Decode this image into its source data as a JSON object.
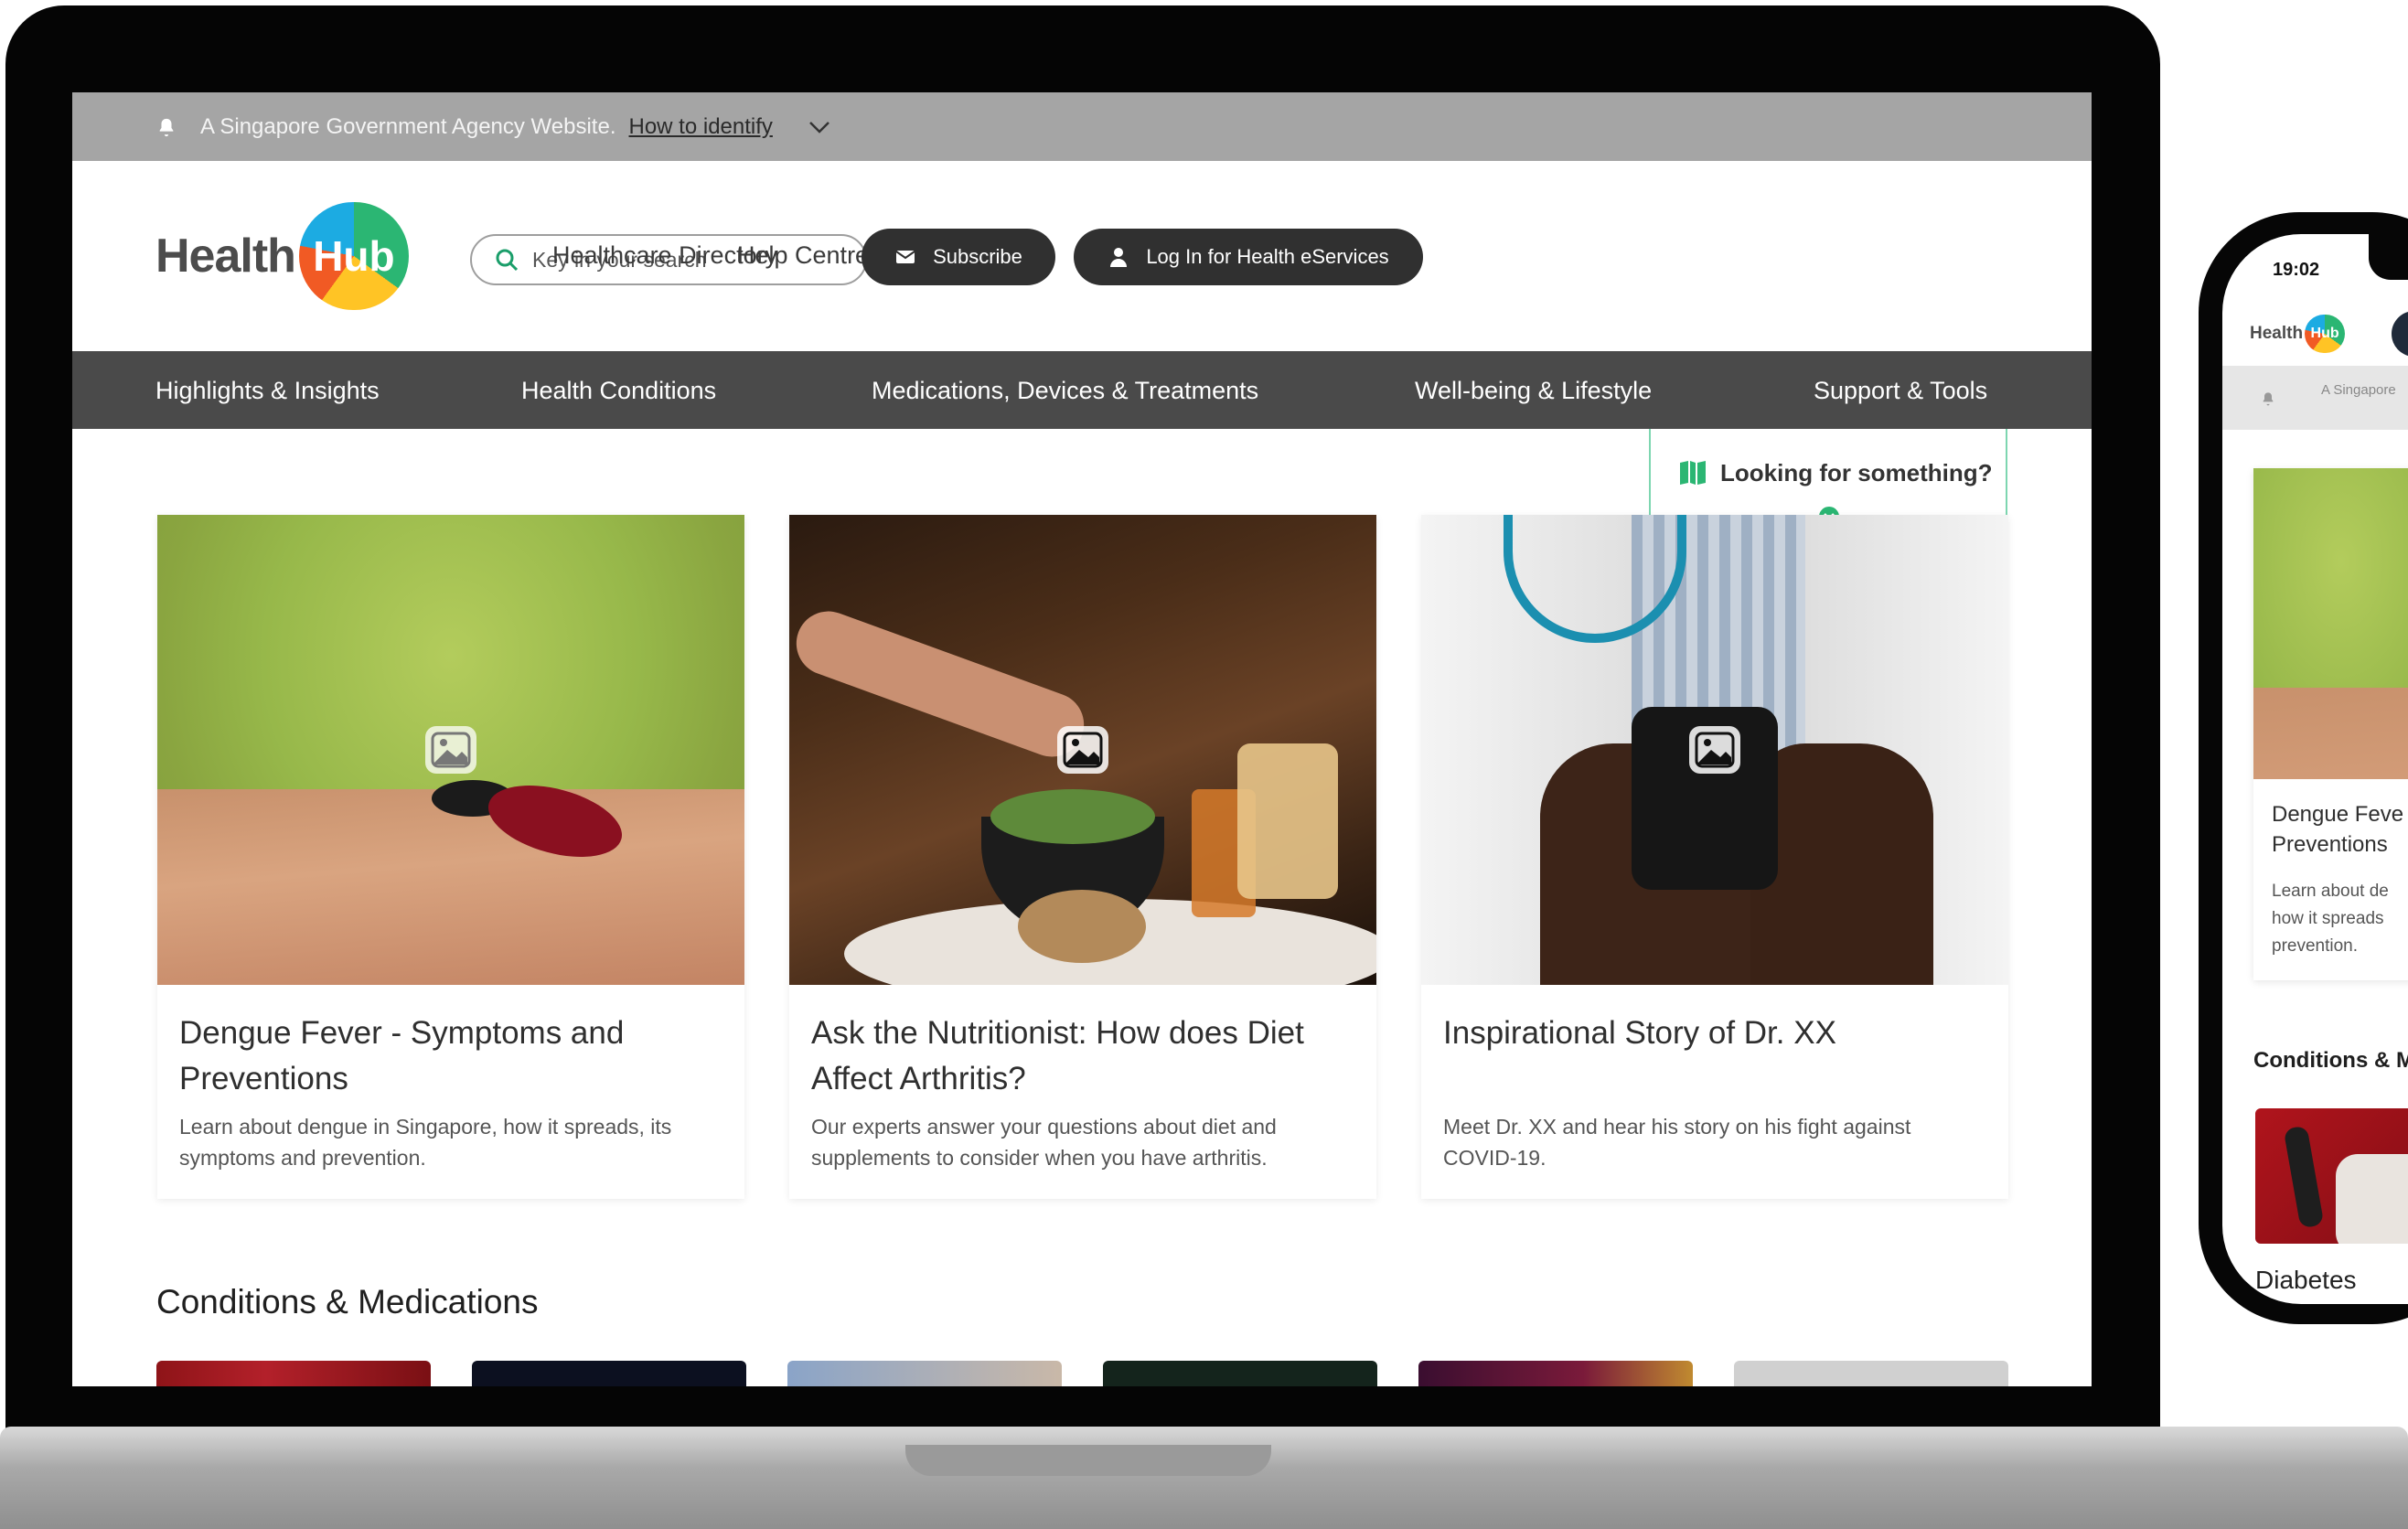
{
  "gov_banner": {
    "text": "A Singapore Government Agency Website.",
    "link": "How to identify"
  },
  "header": {
    "logo_health": "Health",
    "logo_hub": "Hub",
    "search_placeholder": "Key in your search",
    "links": [
      "Healthcare Directory",
      "Help Centre"
    ],
    "subscribe_label": "Subscribe",
    "login_label": "Log In for Health eServices"
  },
  "main_nav": [
    "Highlights & Insights",
    "Health Conditions",
    "Medications, Devices & Treatments",
    "Well-being & Lifestyle",
    "Support & Tools"
  ],
  "finder": {
    "label": "Looking for something?"
  },
  "cards": [
    {
      "title": "Dengue Fever - Symptoms and Preventions",
      "description": "Learn about dengue in Singapore, how it spreads, its symptoms and prevention."
    },
    {
      "title": "Ask the Nutritionist: How does Diet Affect Arthritis?",
      "description": "Our experts answer your questions about diet and supplements to consider when you have arthritis."
    },
    {
      "title": "Inspirational Story of Dr. XX",
      "description": "Meet Dr. XX and hear his story on his fight against COVID-19."
    }
  ],
  "conditions_section": {
    "title": "Conditions & Medications"
  },
  "phone": {
    "time": "19:02",
    "logo_health": "Health",
    "logo_hub": "Hub",
    "banner_text": "A Singapore",
    "card_title": "Dengue Fever - Symptoms and Preventions",
    "card_title_line1": "Dengue Feve",
    "card_title_line2": "Preventions",
    "card_desc_line1": "Learn about de",
    "card_desc_line2": "how it spreads",
    "card_desc_line3": "prevention.",
    "section_title": "Conditions & M",
    "item_title": "Diabetes"
  },
  "colors": {
    "brand_green": "#2bb673",
    "dark_button": "#303030",
    "nav_bar": "#4a4a4a",
    "gov_banner": "#a5a5a5"
  }
}
